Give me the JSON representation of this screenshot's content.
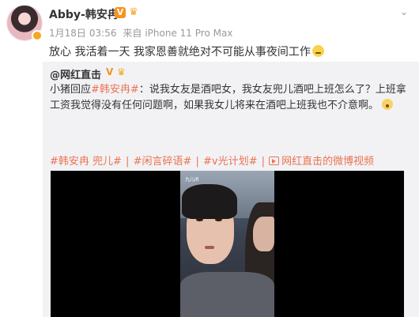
{
  "post": {
    "author": "Abby-韩安冉",
    "badge_v": "V",
    "badge_crown": "♛",
    "date": "1月18日",
    "time": "03:56",
    "source_prefix": "来自",
    "device": "iPhone 11 Pro Max",
    "text": "放心 我活着一天 我家恩善就绝对不可能从事夜间工作",
    "menu_icon": "chevron-down-icon"
  },
  "repost": {
    "author": "@网红直击",
    "badge_v": "V",
    "badge_crown": "♛",
    "reply_prefix": "小猪回应",
    "reply_tag": "#韩安冉#",
    "reply_body": "：说我女友是酒吧女，我女友兜儿酒吧上班怎么了？上班拿工资我觉得没有任何问题啊，如果我女儿将来在酒吧上班我也不介意啊。",
    "tags": [
      "#韩安冉 兜儿#",
      "#闲言碎语#",
      "#v光计划#"
    ],
    "video_link": "网红直击的微博视频",
    "video_overlay_label": "九儿ifi"
  },
  "colors": {
    "accent": "#eb7350",
    "meta": "#999999",
    "repost_bg": "#f2f2f5",
    "badge": "#f7931e"
  }
}
